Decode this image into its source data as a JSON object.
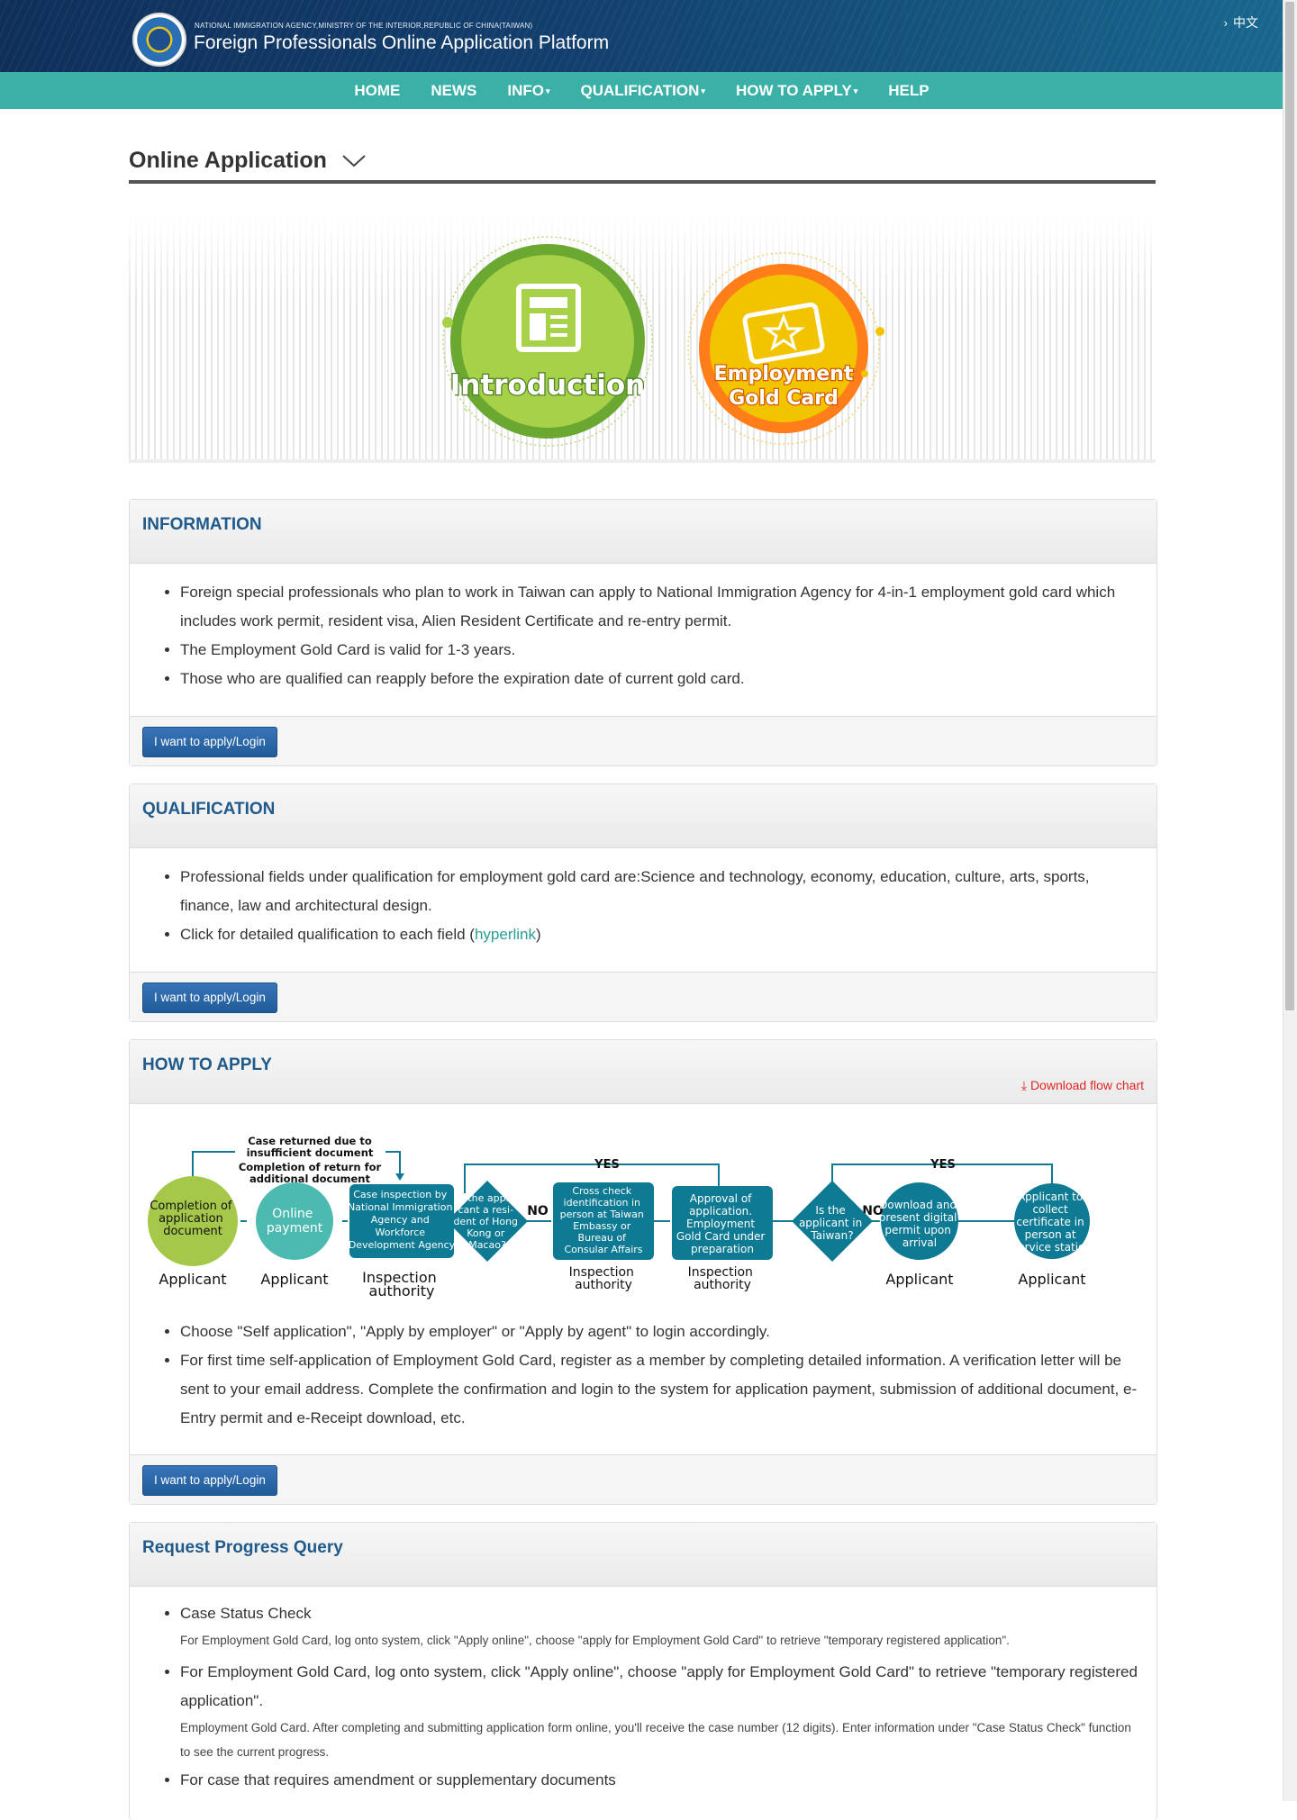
{
  "header": {
    "agency": "NATIONAL IMMIGRATION AGENCY,MINISTRY OF THE INTERIOR,REPUBLIC OF CHINA(TAIWAN)",
    "title": "Foreign Professionals Online Application Platform",
    "lang": "中文"
  },
  "nav": {
    "home": "HOME",
    "news": "NEWS",
    "info": "INFO",
    "qualification": "QUALIFICATION",
    "how_to_apply": "HOW TO APPLY",
    "help": "HELP"
  },
  "page_title": "Online Application",
  "banner": {
    "introduction": "Introduction",
    "gold_card_line1": "Employment",
    "gold_card_line2": "Gold Card"
  },
  "information": {
    "title": "INFORMATION",
    "items": [
      "Foreign special professionals who plan to work in Taiwan can apply to National Immigration Agency for 4-in-1 employment gold card which includes work permit, resident visa, Alien Resident Certificate and re-entry permit.",
      "The Employment Gold Card is valid for 1-3 years.",
      "Those who are qualified can reapply before the expiration date of current gold card."
    ],
    "button": "I want to apply/Login"
  },
  "qualification": {
    "title": "QUALIFICATION",
    "item1": "Professional fields under qualification for employment gold card are:Science and technology, economy, education, culture, arts, sports, finance, law and architectural design.",
    "item2_prefix": "Click for detailed qualification to each field (",
    "item2_link": "hyperlink",
    "item2_suffix": ")",
    "button": "I want to apply/Login"
  },
  "how_to_apply": {
    "title": "HOW TO APPLY",
    "download": "Download flow chart",
    "flow": {
      "returned1": "Case returned due to",
      "returned2": "insufficient document",
      "completion_return1": "Completion of return for",
      "completion_return2": "additional document",
      "yes": "YES",
      "no": "NO",
      "node1": [
        "Completion of",
        "application",
        "document"
      ],
      "node2": [
        "Online",
        "payment"
      ],
      "node3": [
        "Case inspection by",
        "National Immigration",
        "Agency and",
        "Workforce",
        "Development Agency"
      ],
      "node4": [
        "Is the appli-",
        "cant a resi-",
        "dent of Hong",
        "Kong or",
        "Macao?"
      ],
      "node5": [
        "Cross check",
        "identification in",
        "person at Taiwan",
        "Embassy or",
        "Bureau of",
        "Consular Affairs"
      ],
      "node6": [
        "Approval of",
        "application.",
        "Employment",
        "Gold Card under",
        "preparation"
      ],
      "node7": [
        "Is the",
        "applicant in",
        "Taiwan?"
      ],
      "node8": [
        "Download and",
        "present digital",
        "permit upon",
        "arrival"
      ],
      "node9": [
        "Applicant to",
        "collect",
        "certificate in",
        "person at",
        "service station"
      ],
      "applicant": "Applicant",
      "inspection1": "Inspection",
      "inspection2": "authority"
    },
    "items": [
      "Choose \"Self application\", \"Apply by employer\" or \"Apply by agent\" to login accordingly.",
      "For first time self-application of Employment Gold Card, register as a member by completing detailed information. A verification letter will be sent to your email address. Complete the confirmation and login to the system for application payment, submission of additional document, e-Entry permit and e-Receipt download, etc."
    ],
    "button": "I want to apply/Login"
  },
  "progress": {
    "title": "Request Progress Query",
    "item1": "Case Status Check",
    "item1_note": "For Employment Gold Card, log onto system, click \"Apply online\", choose \"apply for Employment Gold Card\" to retrieve \"temporary registered application\".",
    "item2": "For Employment Gold Card, log onto system, click \"Apply online\", choose \"apply for Employment Gold Card\" to retrieve \"temporary registered application\".",
    "item2_note": "Employment Gold Card. After completing and submitting application form online, you'll receive the case number (12 digits). Enter information under \"Case Status Check\" function to see the current progress.",
    "item3": "For case that requires amendment or supplementary documents"
  },
  "colors": {
    "header": "#123f6e",
    "nav": "#3ab0a6",
    "panel_title": "#1f5a8a",
    "button": "#2a64a6",
    "link": "#2a9c94",
    "download": "#e02424",
    "flow_teal": "#0e7a93"
  }
}
